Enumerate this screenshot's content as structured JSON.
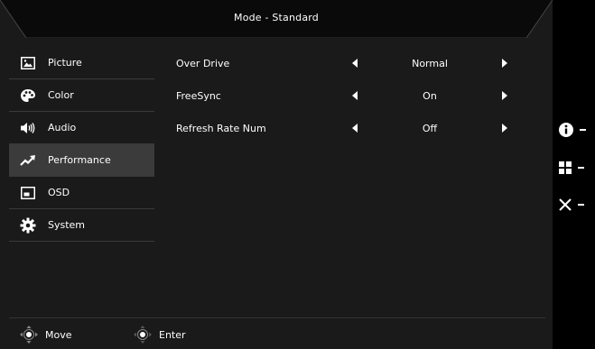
{
  "header": {
    "title": "Mode - Standard"
  },
  "sidebar": {
    "items": [
      {
        "label": "Picture",
        "icon": "picture-icon",
        "active": false
      },
      {
        "label": "Color",
        "icon": "palette-icon",
        "active": false
      },
      {
        "label": "Audio",
        "icon": "speaker-icon",
        "active": false
      },
      {
        "label": "Performance",
        "icon": "trend-up-icon",
        "active": true
      },
      {
        "label": "OSD",
        "icon": "osd-window-icon",
        "active": false
      },
      {
        "label": "System",
        "icon": "gear-icon",
        "active": false
      }
    ]
  },
  "settings": {
    "rows": [
      {
        "label": "Over Drive",
        "value": "Normal"
      },
      {
        "label": "FreeSync",
        "value": "On"
      },
      {
        "label": "Refresh Rate Num",
        "value": "Off"
      }
    ]
  },
  "footer": {
    "move_label": "Move",
    "enter_label": "Enter"
  },
  "side_keys": [
    {
      "icon": "info-icon"
    },
    {
      "icon": "grid-icon"
    },
    {
      "icon": "close-icon"
    }
  ],
  "colors": {
    "panel_bg": "#1a1a1a",
    "active_item_bg": "#3b3b3b",
    "text": "#ffffff",
    "outer_bg": "#000000"
  }
}
